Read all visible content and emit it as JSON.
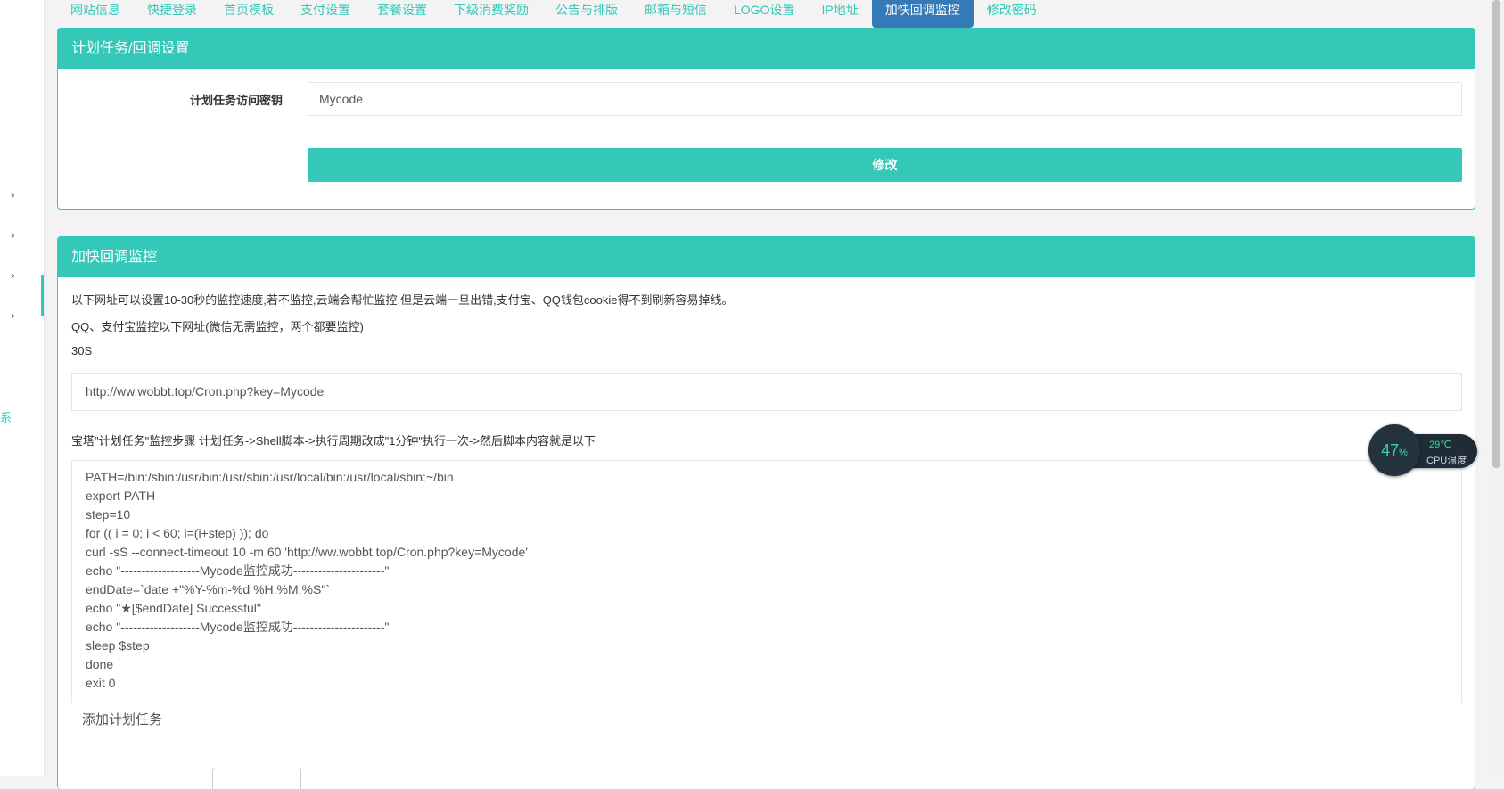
{
  "tabs": [
    {
      "label": "网站信息"
    },
    {
      "label": "快捷登录"
    },
    {
      "label": "首页模板"
    },
    {
      "label": "支付设置"
    },
    {
      "label": "套餐设置"
    },
    {
      "label": "下级消费奖励"
    },
    {
      "label": "公告与排版"
    },
    {
      "label": "邮箱与短信"
    },
    {
      "label": "LOGO设置"
    },
    {
      "label": "IP地址"
    },
    {
      "label": "加快回调监控",
      "active": true
    },
    {
      "label": "修改密码"
    }
  ],
  "sidebar": {
    "arrow": "›",
    "fragment_text": "系"
  },
  "cron_panel": {
    "title": "计划任务/回调设置",
    "key_label": "计划任务访问密钥",
    "key_value": "Mycode",
    "submit_label": "修改"
  },
  "monitor_panel": {
    "title": "加快回调监控",
    "intro": "以下网址可以设置10-30秒的监控速度,若不监控,云端会帮忙监控,但是云端一旦出错,支付宝、QQ钱包cookie得不到刷新容易掉线。",
    "note": "QQ、支付宝监控以下网址(微信无需监控，两个都要监控)",
    "interval": "30S",
    "url": "http://ww.wobbt.top/Cron.php?key=Mycode",
    "bt_steps": "宝塔\"计划任务\"监控步骤 计划任务->Shell脚本->执行周期改成\"1分钟\"执行一次->然后脚本内容就是以下",
    "script": "PATH=/bin:/sbin:/usr/bin:/usr/sbin:/usr/local/bin:/usr/local/sbin:~/bin\nexport PATH\nstep=10\nfor (( i = 0; i < 60; i=(i+step) )); do\ncurl -sS --connect-timeout 10 -m 60 'http://ww.wobbt.top/Cron.php?key=Mycode'\necho \"-------------------Mycode监控成功----------------------\"\nendDate=`date +\"%Y-%m-%d %H:%M:%S\"`\necho \"★[$endDate] Successful\"\necho \"-------------------Mycode监控成功----------------------\"\nsleep $step\ndone\nexit 0",
    "add_task_title": "添加计划任务"
  },
  "cpu_widget": {
    "percent": "47",
    "percent_unit": "%",
    "temperature": "29℃",
    "label": "CPU温度"
  },
  "colors": {
    "accent": "#34c8b9",
    "active_tab": "#337ab7"
  }
}
